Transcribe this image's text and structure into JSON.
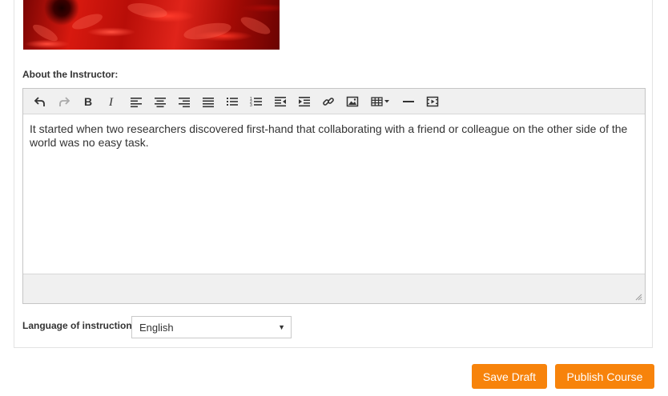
{
  "about_label": "About the Instructor:",
  "editor": {
    "content": "It started when two researchers discovered first-hand that collaborating with a friend or colleague on the other side of the world was no easy task.",
    "toolbar": [
      {
        "name": "undo-icon",
        "enabled": true
      },
      {
        "name": "redo-icon",
        "enabled": false
      },
      {
        "name": "bold-icon",
        "enabled": true
      },
      {
        "name": "italic-icon",
        "enabled": true
      },
      {
        "name": "align-left-icon",
        "enabled": true
      },
      {
        "name": "align-center-icon",
        "enabled": true
      },
      {
        "name": "align-right-icon",
        "enabled": true
      },
      {
        "name": "align-justify-icon",
        "enabled": true
      },
      {
        "name": "bullet-list-icon",
        "enabled": true
      },
      {
        "name": "numbered-list-icon",
        "enabled": true
      },
      {
        "name": "outdent-icon",
        "enabled": true
      },
      {
        "name": "indent-icon",
        "enabled": true
      },
      {
        "name": "link-icon",
        "enabled": true
      },
      {
        "name": "image-icon",
        "enabled": true
      },
      {
        "name": "table-icon",
        "enabled": true
      },
      {
        "name": "horizontal-rule-icon",
        "enabled": true
      },
      {
        "name": "media-icon",
        "enabled": true
      }
    ]
  },
  "language": {
    "label": "Language of instruction:",
    "selected": "English"
  },
  "buttons": {
    "save_draft": "Save Draft",
    "publish_course": "Publish Course"
  },
  "colors": {
    "accent": "#f7830b",
    "toolbar_bg": "#f0f0f0"
  }
}
